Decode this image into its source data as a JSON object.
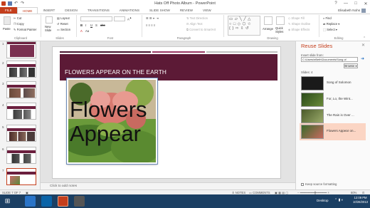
{
  "window": {
    "title": "Hats Off Photo Album - PowerPoint"
  },
  "tabs": [
    "FILE",
    "HOME",
    "INSERT",
    "DESIGN",
    "TRANSITIONS",
    "ANIMATIONS",
    "SLIDE SHOW",
    "REVIEW",
    "VIEW"
  ],
  "user": "Elisabeth Nohs",
  "ribbon": {
    "clipboard": {
      "paste": "Paste",
      "cut": "Cut",
      "copy": "Copy",
      "format_painter": "Format Painter",
      "label": "Clipboard"
    },
    "slides": {
      "new_slide": "New Slide",
      "layout": "Layout",
      "reset": "Reset",
      "section": "Section",
      "label": "Slides"
    },
    "font": {
      "label": "Font",
      "bold": "B",
      "italic": "I",
      "underline": "U",
      "strike": "S",
      "abc": "abc"
    },
    "paragraph": {
      "text_direction": "Text Direction",
      "align_text": "Align Text",
      "convert": "Convert to SmartArt",
      "label": "Paragraph"
    },
    "drawing": {
      "arrange": "Arrange",
      "quick_styles": "Quick Styles",
      "shape_fill": "Shape Fill",
      "shape_outline": "Shape Outline",
      "shape_effects": "Shape Effects",
      "label": "Drawing"
    },
    "editing": {
      "find": "Find",
      "replace": "Replace",
      "select": "Select",
      "label": "Editing"
    }
  },
  "thumbnails": [
    "1",
    "2",
    "3",
    "4",
    "5",
    "6",
    "7"
  ],
  "slide": {
    "title": "FLOWERS APPEAR ON THE EARTH",
    "photo_line1": "Flowers",
    "photo_line2": "Appear"
  },
  "notes_placeholder": "Click to add notes",
  "pane": {
    "title": "Reuse Slides",
    "insert_label": "Insert slide from:",
    "path_value": "C:\\Users\\eBeth\\Documents\\Song of",
    "browse_label": "Browse",
    "slides_count": "Slides: 4",
    "items": [
      "Song of Solomon",
      "For, Lo, the Wint...",
      "The Rain is Over ...",
      "Flowers Appear on..."
    ],
    "keep_formatting": "Keep source formatting"
  },
  "status": {
    "slide_info": "SLIDE 7 OF 7",
    "notes": "NOTES",
    "comments": "COMMENTS",
    "zoom": "60%"
  },
  "taskbar": {
    "desktop": "Desktop",
    "time": "12:09 PM",
    "date": "10/26/2013"
  },
  "colors": {
    "accent": "#c43e1c",
    "banner": "#5c1a36",
    "taskbar": "#1b3f63"
  }
}
